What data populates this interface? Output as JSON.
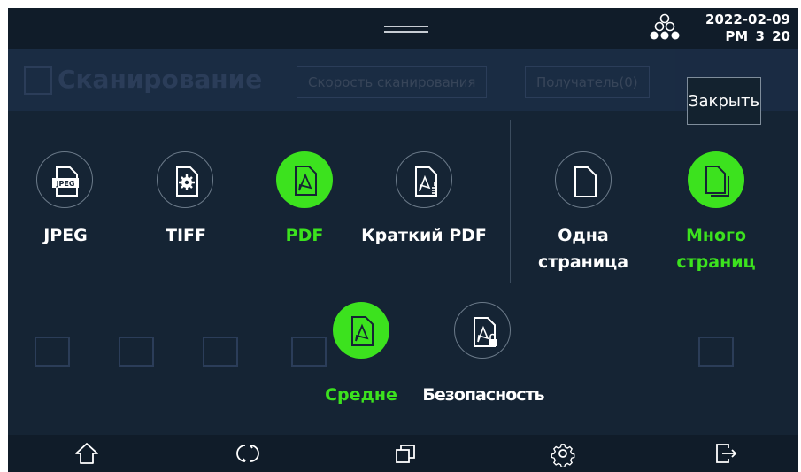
{
  "status_bar": {
    "date": "2022-02-09",
    "time": "PM 3 20"
  },
  "background": {
    "title": "Сканирование",
    "tabs": [
      "Скорость сканирования",
      "Получатель(0)"
    ]
  },
  "popup": {
    "close_label": "Закрыть",
    "formats": [
      {
        "label": "JPEG",
        "icon": "jpeg-file-icon",
        "selected": false
      },
      {
        "label": "TIFF",
        "icon": "tiff-file-icon",
        "selected": false
      },
      {
        "label": "PDF",
        "icon": "pdf-file-icon",
        "selected": true
      },
      {
        "label": "Краткий PDF",
        "icon": "compact-pdf-icon",
        "selected": false
      }
    ],
    "page_modes": [
      {
        "label": "Одна\nстраница",
        "icon": "single-page-icon",
        "selected": false
      },
      {
        "label": "Много\nстраниц",
        "icon": "multi-page-icon",
        "selected": true
      }
    ],
    "pdf_options": [
      {
        "label": "Средне",
        "icon": "pdf-medium-icon",
        "selected": true
      },
      {
        "label": "Безопасность",
        "icon": "secure-pdf-icon",
        "selected": false
      }
    ]
  },
  "nav": [
    "home-icon",
    "refresh-icon",
    "copy-jobs-icon",
    "settings-icon",
    "logout-icon"
  ],
  "colors": {
    "accent": "#3ce21e",
    "background": "#152434",
    "bar": "#101c29"
  }
}
